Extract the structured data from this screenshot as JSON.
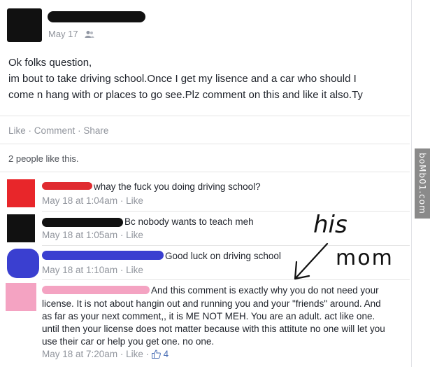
{
  "post": {
    "date": "May 17",
    "audience_icon": "friends-icon",
    "body_lines": [
      "Ok folks question,",
      "im bout to take driving school.Once I get my lisence and a car who should I",
      "come n hang with or places to go see.Plz comment on this and like it also.Ty"
    ],
    "actions": {
      "like": "Like",
      "comment": "Comment",
      "share": "Share",
      "dot": "·"
    },
    "likes_summary": "2 people like this."
  },
  "comments": [
    {
      "avatar_color": "#e8262a",
      "redact_color": "#e02b30",
      "text": "whay the fuck you doing driving school?",
      "time": "May 18 at 1:04am",
      "like": "Like"
    },
    {
      "avatar_color": "#111111",
      "redact_color": "#111111",
      "text": "Bc nobody wants to teach meh",
      "time": "May 18 at 1:05am",
      "like": "Like"
    },
    {
      "avatar_color": "#3a3fd0",
      "redact_color": "#3a3fd0",
      "text": "Good luck on driving school",
      "time": "May 18 at 1:10am",
      "like": "Like"
    },
    {
      "avatar_color": "#f4a3c2",
      "redact_color": "#f4a3c2",
      "text_lines": [
        "And this comment is exactly why you do not need your",
        "license. It is not about hangin out and running you and your \"friends\" around. And",
        "as far as your next comment,, it is ME NOT MEH. You are an adult. act like one.",
        "until then your license does not matter because with this attitute no one will let you",
        "use their car or help you get one. no one."
      ],
      "time": "May 18 at 7:20am",
      "like": "Like",
      "like_count": "4",
      "like_icon": "thumbs-up-icon"
    }
  ],
  "annotation": {
    "line1": "his",
    "line2": "mom"
  },
  "watermark": "boMb01.com"
}
